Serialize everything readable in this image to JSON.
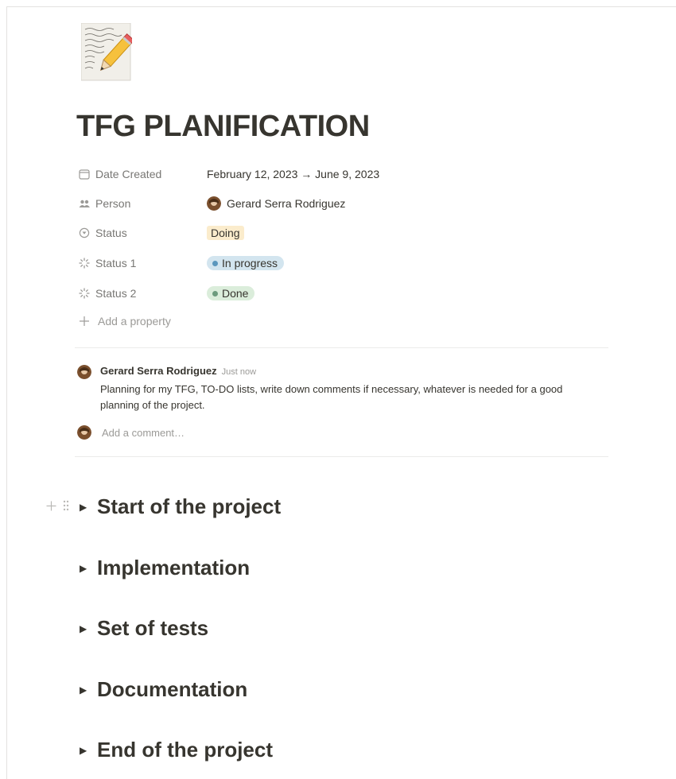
{
  "page": {
    "icon": "memo-pencil-icon",
    "title": "TFG PLANIFICATION"
  },
  "properties": [
    {
      "icon": "calendar-icon",
      "label": "Date Created",
      "value": "February 12, 2023 → June 9, 2023"
    },
    {
      "icon": "people-icon",
      "label": "Person",
      "value": "Gerard Serra Rodriguez"
    },
    {
      "icon": "status-circle-icon",
      "label": "Status",
      "value": "Doing"
    },
    {
      "icon": "loading-icon",
      "label": "Status 1",
      "value": "In progress"
    },
    {
      "icon": "loading-icon",
      "label": "Status 2",
      "value": "Done"
    }
  ],
  "add_property_label": "Add a property",
  "comment": {
    "author": "Gerard Serra Rodriguez",
    "time": "Just now",
    "text": "Planning for my TFG, TO-DO lists, write down comments if necessary, whatever is needed for a good planning of the project."
  },
  "add_comment_placeholder": "Add a comment…",
  "toggles": [
    {
      "label": "Start of the project"
    },
    {
      "label": "Implementation"
    },
    {
      "label": "Set of tests"
    },
    {
      "label": "Documentation"
    },
    {
      "label": "End of the project"
    }
  ],
  "colors": {
    "doing_bg": "#fbeccc",
    "in_progress_bg": "#d3e5ef",
    "in_progress_dot": "#5b97bd",
    "done_bg": "#dbeddb",
    "done_dot": "#6c9b7d"
  }
}
